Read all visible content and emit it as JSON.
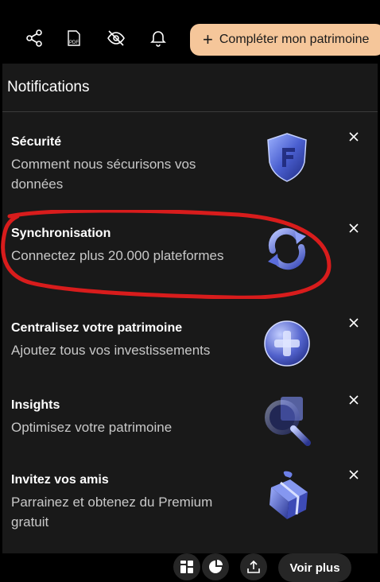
{
  "toolbar": {
    "icons": [
      "share-icon",
      "pdf-icon",
      "eye-off-icon",
      "bell-icon"
    ],
    "cta_label": "Compléter mon patrimoine",
    "cta_icon": "plus-icon",
    "cta_color": "#f5c69a",
    "pdf_text": "PDF"
  },
  "panel": {
    "title": "Notifications"
  },
  "notifications": [
    {
      "title": "Sécurité",
      "description": "Comment nous sécurisons vos données",
      "icon": "shield-icon"
    },
    {
      "title": "Synchronisation",
      "description": "Connectez plus 20.000 plateformes",
      "icon": "sync-icon"
    },
    {
      "title": "Centralisez votre patrimoine",
      "description": "Ajoutez tous vos investissements",
      "icon": "plus-circle-icon"
    },
    {
      "title": "Insights",
      "description": "Optimisez votre patrimoine",
      "icon": "magnifier-icon"
    },
    {
      "title": "Invitez vos amis",
      "description": "Parrainez et obtenez du Premium gratuit",
      "icon": "gift-icon"
    }
  ],
  "bottom": {
    "icons": [
      "grid-icon",
      "pie-chart-icon",
      "upload-icon"
    ],
    "voir_plus": "Voir plus"
  },
  "colors": {
    "background": "#000000",
    "panel": "#191919",
    "text_secondary": "#c8c8c8",
    "annotation": "#d81c1c"
  }
}
